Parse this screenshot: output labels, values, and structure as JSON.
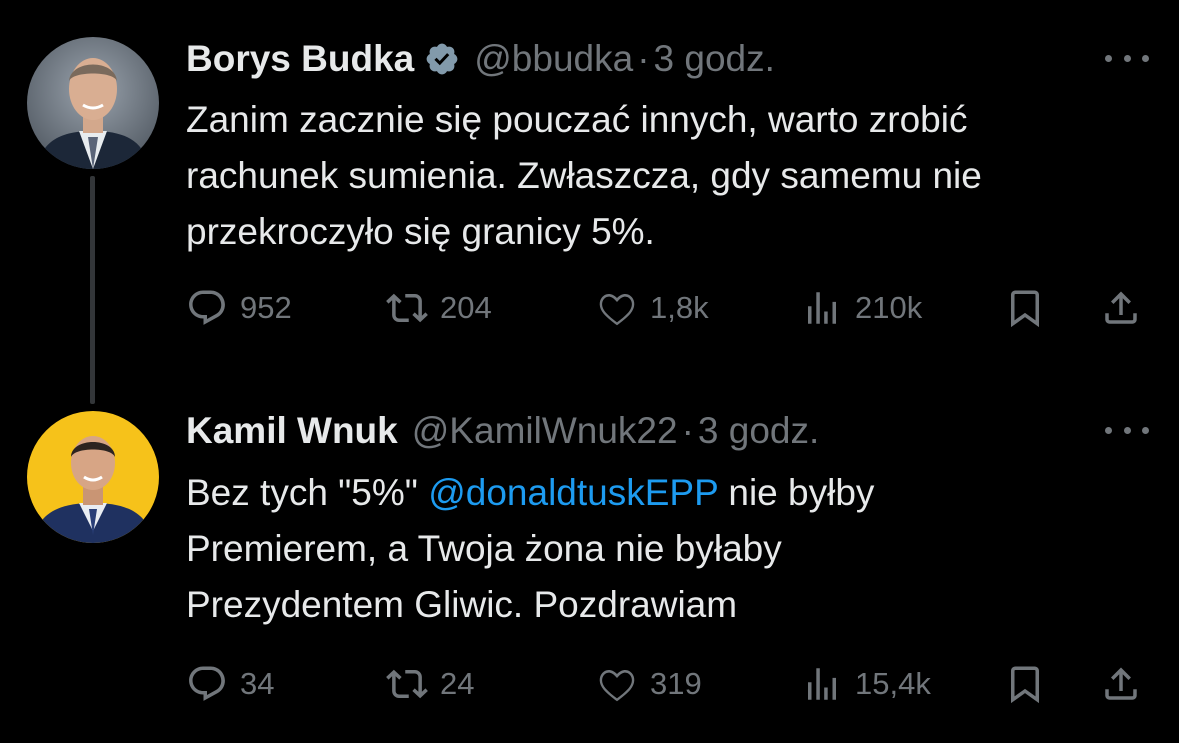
{
  "colors": {
    "background": "#000000",
    "text": "#e7e9ea",
    "muted": "#71767b",
    "link": "#1d9bf0",
    "verified": "#829aab"
  },
  "tweets": [
    {
      "name": "Borys Budka",
      "handle": "@bbudka",
      "separator": "·",
      "time": "3 godz.",
      "verified": true,
      "text_lines": [
        "Zanim zacznie się pouczać innych, warto zrobić",
        "rachunek sumienia. Zwłaszcza, gdy samemu nie",
        "przekroczyło się granicy 5%."
      ],
      "replies": "952",
      "reposts": "204",
      "likes": "1,8k",
      "views": "210k"
    },
    {
      "name": "Kamil Wnuk",
      "handle": "@KamilWnuk22",
      "separator": "·",
      "time": "3 godz.",
      "verified": false,
      "text_line1_before": "Bez tych \"5%\" ",
      "mention": "@donaldtuskEPP",
      "text_line1_after": " nie byłby",
      "text_lines_rest": [
        "Premierem, a Twoja żona nie byłaby",
        "Prezydentem Gliwic. Pozdrawiam"
      ],
      "replies": "34",
      "reposts": "24",
      "likes": "319",
      "views": "15,4k"
    }
  ],
  "icons": {
    "reply": "speech-bubble-icon",
    "repost": "repost-arrows-icon",
    "like": "heart-icon",
    "views": "bar-chart-icon",
    "bookmark": "bookmark-icon",
    "share": "share-upload-icon",
    "more": "more-dots-icon",
    "verified": "verified-badge-icon"
  }
}
